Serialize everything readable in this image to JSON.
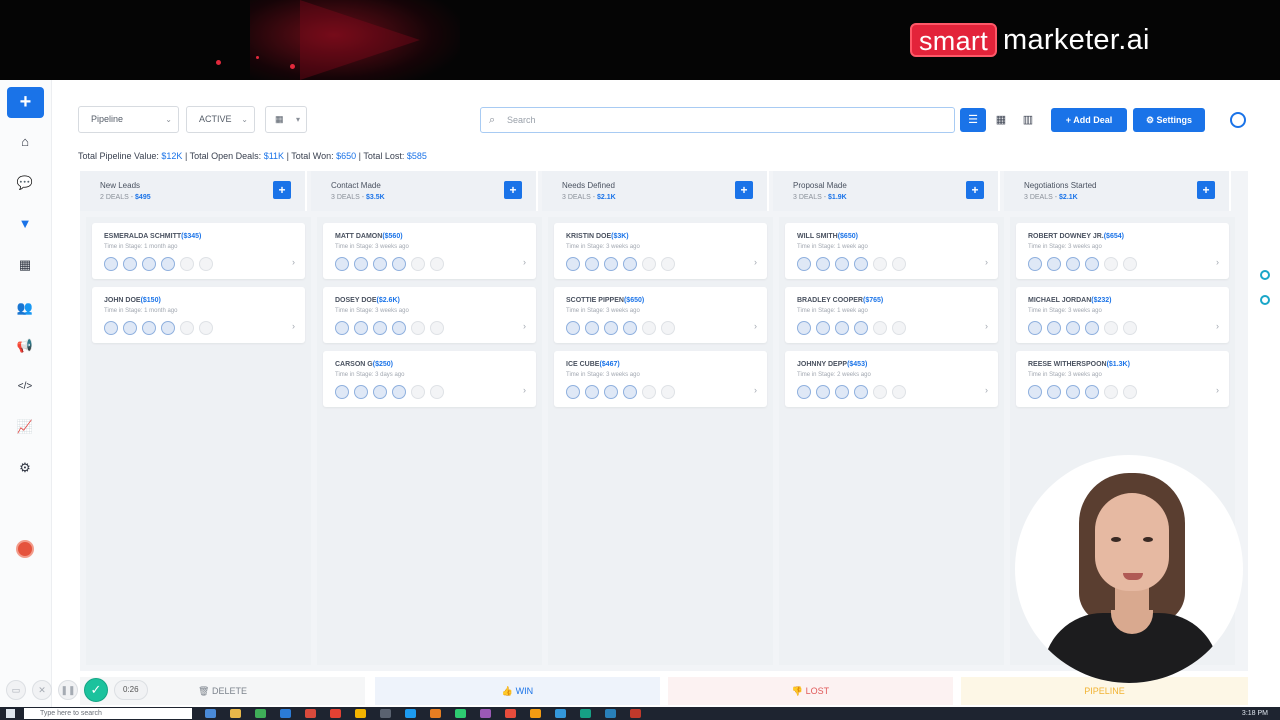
{
  "brand": {
    "part1": "smart",
    "part2": "marketer.ai"
  },
  "sidebar": {
    "items": [
      {
        "name": "home-icon",
        "glyph": "⌂"
      },
      {
        "name": "chat-icon",
        "glyph": "💬"
      },
      {
        "name": "filter-icon",
        "glyph": "▼"
      },
      {
        "name": "calendar-icon",
        "glyph": "▦"
      },
      {
        "name": "users-icon",
        "glyph": "👥"
      },
      {
        "name": "megaphone-icon",
        "glyph": "📢"
      },
      {
        "name": "code-icon",
        "glyph": "</>"
      },
      {
        "name": "chart-icon",
        "glyph": "📈"
      },
      {
        "name": "settings-group-icon",
        "glyph": "⚙"
      }
    ]
  },
  "toolbar": {
    "pipeline_select": "Pipeline",
    "status_select": "ACTIVE",
    "date_select": "▦",
    "search_placeholder": "Search",
    "add_deal": "Add Deal",
    "settings": "Settings"
  },
  "summary": {
    "pipeline_label": "Total Pipeline Value:",
    "pipeline_value": "$12K",
    "open_label": " | Total Open Deals:",
    "open_value": "$11K",
    "won_label": " | Total Won:",
    "won_value": "$650",
    "lost_label": " | Total Lost:",
    "lost_value": "$585"
  },
  "columns": [
    {
      "title": "New Leads",
      "deals": "2 DEALS",
      "value": "$495",
      "cards": [
        {
          "name": "ESMERALDA SCHMITT",
          "amount": "($345)",
          "time": "Time in Stage: 1 month ago"
        },
        {
          "name": "JOHN DOE",
          "amount": "($150)",
          "time": "Time in Stage: 1 month ago"
        }
      ]
    },
    {
      "title": "Contact Made",
      "deals": "3 DEALS",
      "value": "$3.5K",
      "cards": [
        {
          "name": "MATT DAMON",
          "amount": "($560)",
          "time": "Time in Stage: 3 weeks ago"
        },
        {
          "name": "DOSEY DOE",
          "amount": "($2.6K)",
          "time": "Time in Stage: 3 weeks ago"
        },
        {
          "name": "CARSON G",
          "amount": "($250)",
          "time": "Time in Stage: 3 days ago"
        }
      ]
    },
    {
      "title": "Needs Defined",
      "deals": "3 DEALS",
      "value": "$2.1K",
      "cards": [
        {
          "name": "KRISTIN DOE",
          "amount": "($3K)",
          "time": "Time in Stage: 3 weeks ago"
        },
        {
          "name": "SCOTTIE PIPPEN",
          "amount": "($650)",
          "time": "Time in Stage: 3 weeks ago"
        },
        {
          "name": "ICE CUBE",
          "amount": "($467)",
          "time": "Time in Stage: 3 weeks ago"
        }
      ]
    },
    {
      "title": "Proposal Made",
      "deals": "3 DEALS",
      "value": "$1.9K",
      "cards": [
        {
          "name": "WILL SMITH",
          "amount": "($650)",
          "time": "Time in Stage: 1 week ago"
        },
        {
          "name": "BRADLEY COOPER",
          "amount": "($765)",
          "time": "Time in Stage: 1 week ago"
        },
        {
          "name": "JOHNNY DEPP",
          "amount": "($453)",
          "time": "Time in Stage: 2 weeks ago"
        }
      ]
    },
    {
      "title": "Negotiations Started",
      "deals": "3 DEALS",
      "value": "$2.1K",
      "cards": [
        {
          "name": "ROBERT DOWNEY JR.",
          "amount": "($654)",
          "time": "Time in Stage: 3 weeks ago"
        },
        {
          "name": "MICHAEL JORDAN",
          "amount": "($232)",
          "time": "Time in Stage: 3 weeks ago"
        },
        {
          "name": "REESE WITHERSPOON",
          "amount": "($1.3K)",
          "time": "Time in Stage: 3 weeks ago"
        }
      ]
    }
  ],
  "bottom": {
    "delete": "DELETE",
    "win": "WIN",
    "lost": "LOST",
    "pipeline": "PIPELINE"
  },
  "recorder": {
    "time": "0:26"
  },
  "taskbar": {
    "search": "Type here to search",
    "clock": "3:18 PM"
  }
}
